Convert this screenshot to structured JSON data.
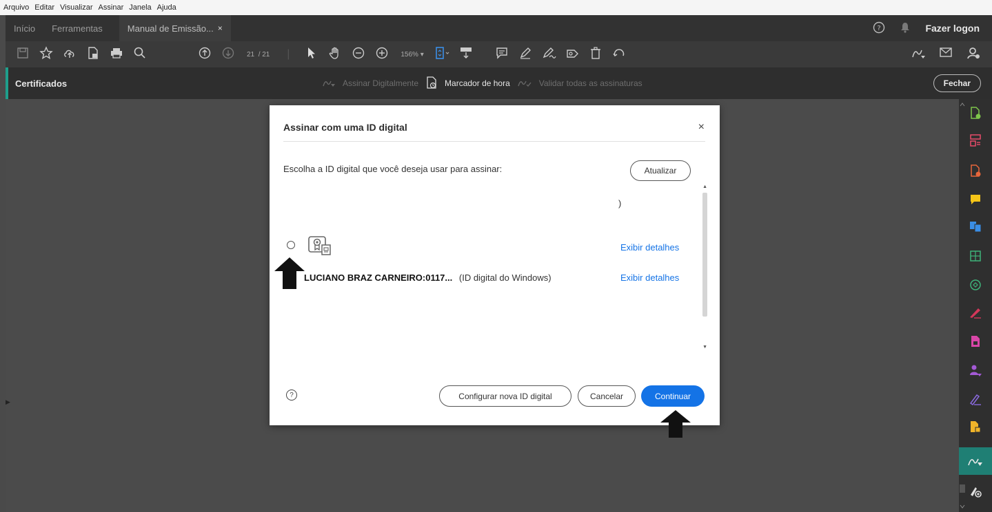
{
  "menubar": {
    "items": [
      "Arquivo",
      "Editar",
      "Visualizar",
      "Assinar",
      "Janela",
      "Ajuda"
    ]
  },
  "tabs": {
    "home": "Início",
    "tools": "Ferramentas",
    "document": "Manual de Emissão...",
    "close": "×",
    "login": "Fazer logon"
  },
  "toolbar": {
    "page_current": "21",
    "page_total": "/ 21",
    "zoom": "156%"
  },
  "certbar": {
    "title": "Certificados",
    "sign_digitally": "Assinar Digitalmente",
    "timestamp": "Marcador de hora",
    "validate_all": "Validar todas as assinaturas",
    "close_button": "Fechar"
  },
  "dialog": {
    "title": "Assinar com uma ID digital",
    "close": "×",
    "prompt": "Escolha a ID digital que você deseja usar para assinar:",
    "refresh_button": "Atualizar",
    "paren": ")",
    "ids": [
      {
        "name": "",
        "type": "",
        "details_link": "Exibir detalhes"
      },
      {
        "name": "LUCIANO BRAZ CARNEIRO:0117...",
        "type": "(ID digital do Windows)",
        "details_link": "Exibir detalhes"
      }
    ],
    "help": "?",
    "configure_button": "Configurar nova ID digital",
    "cancel_button": "Cancelar",
    "continue_button": "Continuar"
  },
  "colors": {
    "accent": "#1473e6",
    "panel_active": "#1f7f74",
    "cert_bar_accent": "#1e9f8c"
  }
}
